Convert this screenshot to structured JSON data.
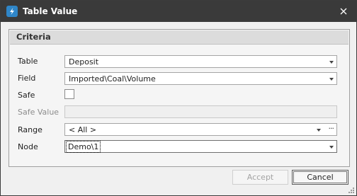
{
  "window": {
    "title": "Table Value"
  },
  "group": {
    "title": "Criteria"
  },
  "fields": {
    "table": {
      "label": "Table",
      "value": "Deposit"
    },
    "field": {
      "label": "Field",
      "value": "Imported\\Coal\\Volume"
    },
    "safe": {
      "label": "Safe",
      "checked": false
    },
    "safe_value": {
      "label": "Safe Value",
      "value": ""
    },
    "range": {
      "label": "Range",
      "value": "< All >"
    },
    "node": {
      "label": "Node",
      "value": "Demo\\1"
    }
  },
  "buttons": {
    "accept": "Accept",
    "cancel": "Cancel"
  },
  "icons": {
    "app": "app-logo-icon",
    "close": "close-icon",
    "ellipsis": "ellipsis-icon",
    "dropdown": "chevron-down-icon"
  },
  "colors": {
    "titlebar": "#3a3a3a",
    "accent": "#2f86c8"
  }
}
